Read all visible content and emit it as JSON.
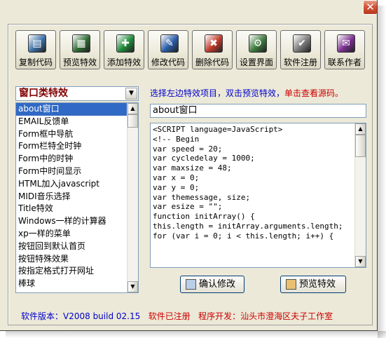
{
  "toolbar": {
    "buttons": [
      {
        "label": "复制代码",
        "icon": "copy-code-icon",
        "color": "#3a6ea5",
        "glyph": "▤"
      },
      {
        "label": "预览特效",
        "icon": "preview-effect-icon",
        "color": "#2e6b34",
        "glyph": "▦"
      },
      {
        "label": "添加特效",
        "icon": "add-effect-icon",
        "color": "#1f8a3a",
        "glyph": "✚"
      },
      {
        "label": "修改代码",
        "icon": "edit-code-icon",
        "color": "#2a5ca8",
        "glyph": "✎"
      },
      {
        "label": "删除代码",
        "icon": "delete-code-icon",
        "color": "#c0392b",
        "glyph": "✖"
      },
      {
        "label": "设置界面",
        "icon": "settings-icon",
        "color": "#3d7a3d",
        "glyph": "⚙"
      },
      {
        "label": "软件注册",
        "icon": "register-icon",
        "color": "#7a7a7a",
        "glyph": "✔"
      },
      {
        "label": "联系作者",
        "icon": "contact-author-icon",
        "color": "#7b2f8f",
        "glyph": "✉"
      }
    ]
  },
  "category_select": {
    "value": "窗口类特效"
  },
  "hint": {
    "blue": "选择左边特效项目，双击预览特效，",
    "red": "单击查看源码。"
  },
  "effects_list": {
    "items": [
      "about窗口",
      "EMAIL反馈单",
      "Form框中导航",
      "Form栏特全时钟",
      "Form中的时钟",
      "Form中时间显示",
      "HTML加入javascript",
      "MIDI音乐选择",
      "Title特效",
      "Windows一样的计算器",
      "xp一样的菜单",
      "按钮回到默认首页",
      "按钮特殊效果",
      "按指定格式打开网址",
      "棒球"
    ],
    "selected_index": 0,
    "scroll_position": 0.0
  },
  "effect_title": {
    "value": "about窗口"
  },
  "code_editor": {
    "lines": [
      "<SCRIPT language=JavaScript>",
      "<!-- Begin",
      "var speed = 20;",
      "var cycledelay = 1000;",
      "var maxsize = 48;",
      "",
      "var x = 0;",
      "var y = 0;",
      "var themessage, size;",
      "var esize = \"\";",
      "",
      "function initArray() {",
      "this.length = initArray.arguments.length;",
      "for (var i = 0; i < this.length; i++) {"
    ],
    "scroll_position": 0.0
  },
  "actions": {
    "confirm_label": "确认修改",
    "preview_label": "预览特效"
  },
  "status": {
    "version_label": "软件版本：V2008 build 02.15",
    "registered_label": "软件已注册",
    "developer_label": "程序开发：汕头市澄海区夫子工作室"
  }
}
